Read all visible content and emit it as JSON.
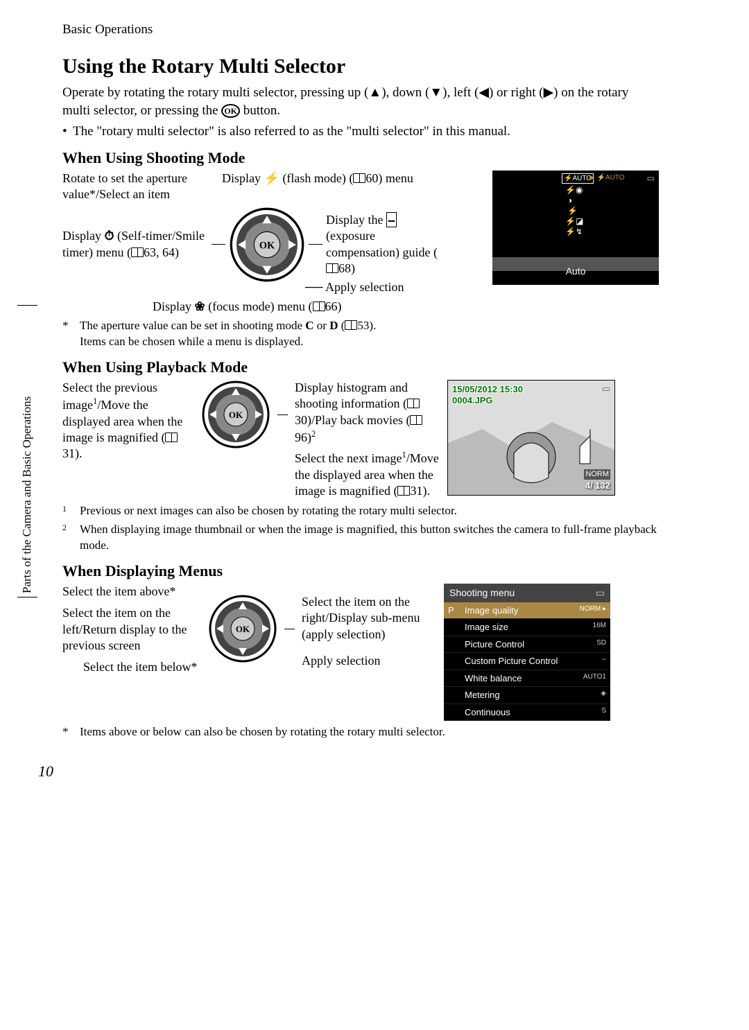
{
  "breadcrumb": "Basic Operations",
  "sidebar_tab": "Parts of the Camera and Basic Operations",
  "page_number": "10",
  "section_title": "Using the Rotary Multi Selector",
  "intro_line1": "Operate by rotating the rotary multi selector, pressing up (▲), down (▼), left (◀) or right (▶) on the rotary multi selector, or pressing the ",
  "intro_line1_end": " button.",
  "bullet1": "The \"rotary multi selector\" is also referred to as the \"multi selector\" in this manual.",
  "shooting": {
    "heading": "When Using Shooting Mode",
    "top_left": "Rotate to set the aperture value*/Select an item",
    "top_right_a": "Display ",
    "top_right_b": " (flash mode) (",
    "top_right_c": "60) menu",
    "left_a": "Display ",
    "left_b": " (Self-timer/Smile timer) menu (",
    "left_c": "63, 64)",
    "right_a": "Display the ",
    "right_b": " (exposure compensation) guide (",
    "right_c": "68)",
    "apply": "Apply selection",
    "bottom_a": "Display ",
    "bottom_b": " (focus mode) menu (",
    "bottom_c": "66)",
    "foot_star_a": "The aperture value can be set in shooting mode ",
    "foot_star_b": " or ",
    "foot_star_c": "  (",
    "foot_star_d": "53).",
    "foot_star_mode1": "C",
    "foot_star_mode2": "D",
    "foot_star2": "Items can be chosen while a menu is displayed.",
    "lcd_auto": "Auto"
  },
  "playback": {
    "heading": "When Using Playback Mode",
    "left_a": "Select the previous image",
    "left_b": "/Move the displayed area when the image is magnified (",
    "left_c": "31).",
    "right_top_a": "Display histogram and shooting information (",
    "right_top_b": "30)/Play back movies (",
    "right_top_c": "96)",
    "right_bot_a": "Select the next image",
    "right_bot_b": "/Move the displayed area when the image is magnified (",
    "right_bot_c": "31).",
    "foot1": "Previous or next images can also be chosen by rotating the rotary multi selector.",
    "foot2": "When displaying image thumbnail or when the image is magnified, this button switches the camera to full-frame playback mode.",
    "lcd_date": "15/05/2012 15:30",
    "lcd_file": "0004.JPG",
    "lcd_norm": "NORM",
    "lcd_count": "4/ 132"
  },
  "menus": {
    "heading": "When Displaying Menus",
    "top": "Select the item above*",
    "left": "Select the item on the left/Return display to the previous screen",
    "bottom": "Select the item below*",
    "right": "Select the item on the right/Display sub-menu (apply selection)",
    "apply": "Apply selection",
    "foot": "Items above or below can also be chosen by rotating the rotary multi selector.",
    "lcd_title": "Shooting menu",
    "lcd_items": [
      {
        "label": "Image quality",
        "val": "NORM ▸"
      },
      {
        "label": "Image size",
        "val": "16M"
      },
      {
        "label": "Picture Control",
        "val": "SD"
      },
      {
        "label": "Custom Picture Control",
        "val": "--"
      },
      {
        "label": "White balance",
        "val": "AUTO1"
      },
      {
        "label": "Metering",
        "val": "◈"
      },
      {
        "label": "Continuous",
        "val": "S"
      }
    ]
  }
}
